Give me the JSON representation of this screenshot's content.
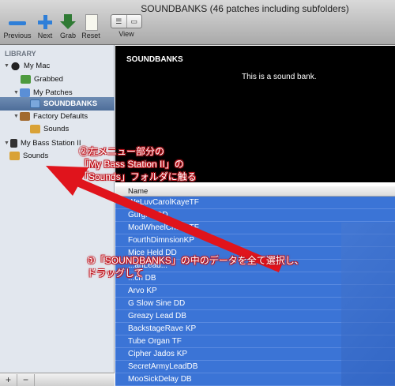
{
  "window": {
    "title": "SOUNDBANKS (46 patches including subfolders)"
  },
  "toolbar": {
    "previous_label": "Previous",
    "next_label": "Next",
    "grab_label": "Grab",
    "reset_label": "Reset",
    "view_label": "View"
  },
  "sidebar": {
    "heading": "LIBRARY",
    "items": [
      {
        "label": "My Mac",
        "icon": "mac-icon"
      },
      {
        "label": "Grabbed",
        "icon": "folder-icon"
      },
      {
        "label": "My Patches",
        "icon": "folder-icon"
      },
      {
        "label": "SOUNDBANKS",
        "icon": "soundbank-icon",
        "selected": true
      },
      {
        "label": "Factory Defaults",
        "icon": "factory-icon"
      },
      {
        "label": "Sounds",
        "icon": "sounds-icon"
      },
      {
        "label": "My Bass Station II",
        "icon": "device-icon"
      },
      {
        "label": "Sounds",
        "icon": "sounds-icon"
      }
    ],
    "footer": {
      "add_label": "+",
      "remove_label": "−"
    }
  },
  "info": {
    "bank_title": "SOUNDBANKS",
    "description": "This is a sound bank."
  },
  "table": {
    "column_name": "Name",
    "rows": [
      "WeLuvCarolKayeTF",
      "Gurgler DD",
      "ModWheelChord TF",
      "FourthDimnsionKP",
      "Mice Held DD",
      "...anLead...",
      "...ch DB",
      "Arvo KP",
      "G Slow Sine DD",
      "Greazy Lead DB",
      "BackstageRave KP",
      "Tube Organ TF",
      "Cipher Jados KP",
      "SecretArmyLeadDB",
      "MooSickDelay DB"
    ]
  },
  "annotations": {
    "step2_line1": "②左メニュー部分の",
    "step2_line2": "「My Bass Station II」の",
    "step2_line3": "「Sounds」フォルダに触る",
    "step1_line1": "①「SOUNDBANKS」の中のデータを全て選択し、",
    "step1_line2": "ドラッグして"
  },
  "colors": {
    "selection_blue": "#3b74d6",
    "annotation_red": "#c0161f",
    "sidebar_bg": "#e2e7ee"
  }
}
